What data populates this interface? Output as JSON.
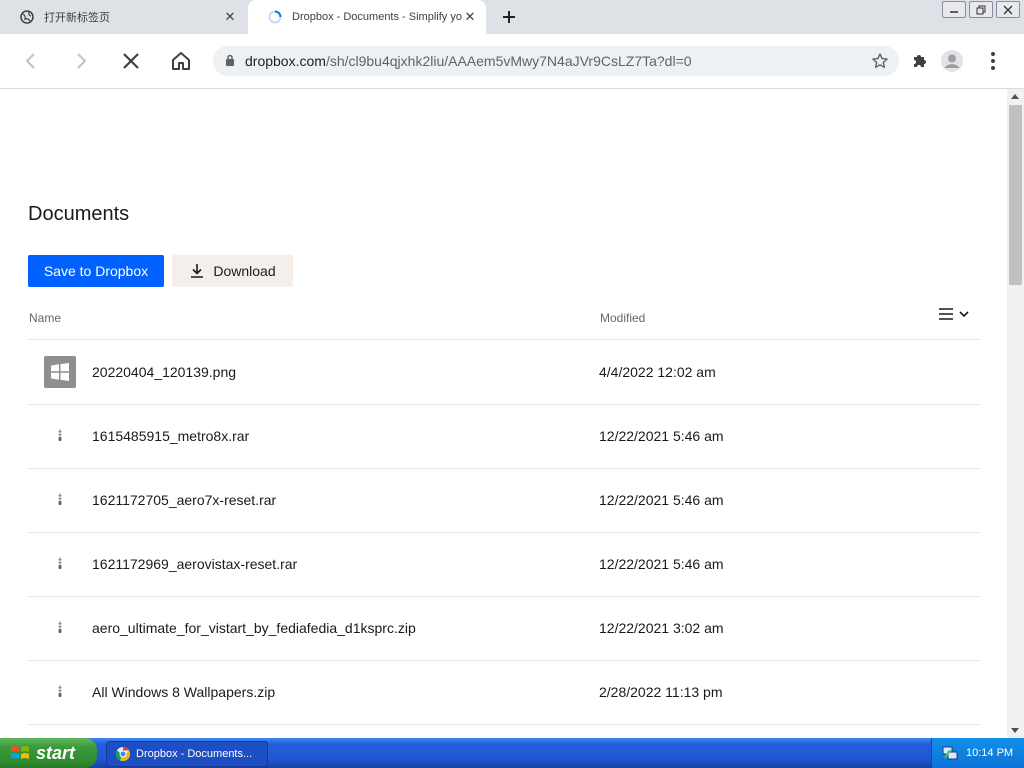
{
  "browser": {
    "tabs": [
      {
        "title": "打开新标签页",
        "active": false
      },
      {
        "title": "Dropbox - Documents - Simplify your",
        "active": true
      }
    ],
    "url_host": "dropbox.com",
    "url_path": "/sh/cl9bu4qjxhk2liu/AAAem5vMwy7N4aJVr9CsLZ7Ta?dl=0"
  },
  "page": {
    "title": "Documents",
    "save_label": "Save to Dropbox",
    "download_label": "Download",
    "col_name": "Name",
    "col_modified": "Modified",
    "files": [
      {
        "name": "20220404_120139.png",
        "modified": "4/4/2022 12:02 am",
        "icon": "image-file-icon"
      },
      {
        "name": "1615485915_metro8x.rar",
        "modified": "12/22/2021 5:46 am",
        "icon": "zip-file-icon"
      },
      {
        "name": "1621172705_aero7x-reset.rar",
        "modified": "12/22/2021 5:46 am",
        "icon": "zip-file-icon"
      },
      {
        "name": "1621172969_aerovistax-reset.rar",
        "modified": "12/22/2021 5:46 am",
        "icon": "zip-file-icon"
      },
      {
        "name": "aero_ultimate_for_vistart_by_fediafedia_d1ksprc.zip",
        "modified": "12/22/2021 3:02 am",
        "icon": "zip-file-icon"
      },
      {
        "name": "All Windows 8 Wallpapers.zip",
        "modified": "2/28/2022 11:13 pm",
        "icon": "zip-file-icon"
      }
    ]
  },
  "taskbar": {
    "start_label": "start",
    "task_label": "Dropbox - Documents...",
    "clock": "10:14 PM"
  },
  "colors": {
    "accent": "#0061fe",
    "download_bg": "#f5efeb",
    "taskbar": "#245edb"
  }
}
